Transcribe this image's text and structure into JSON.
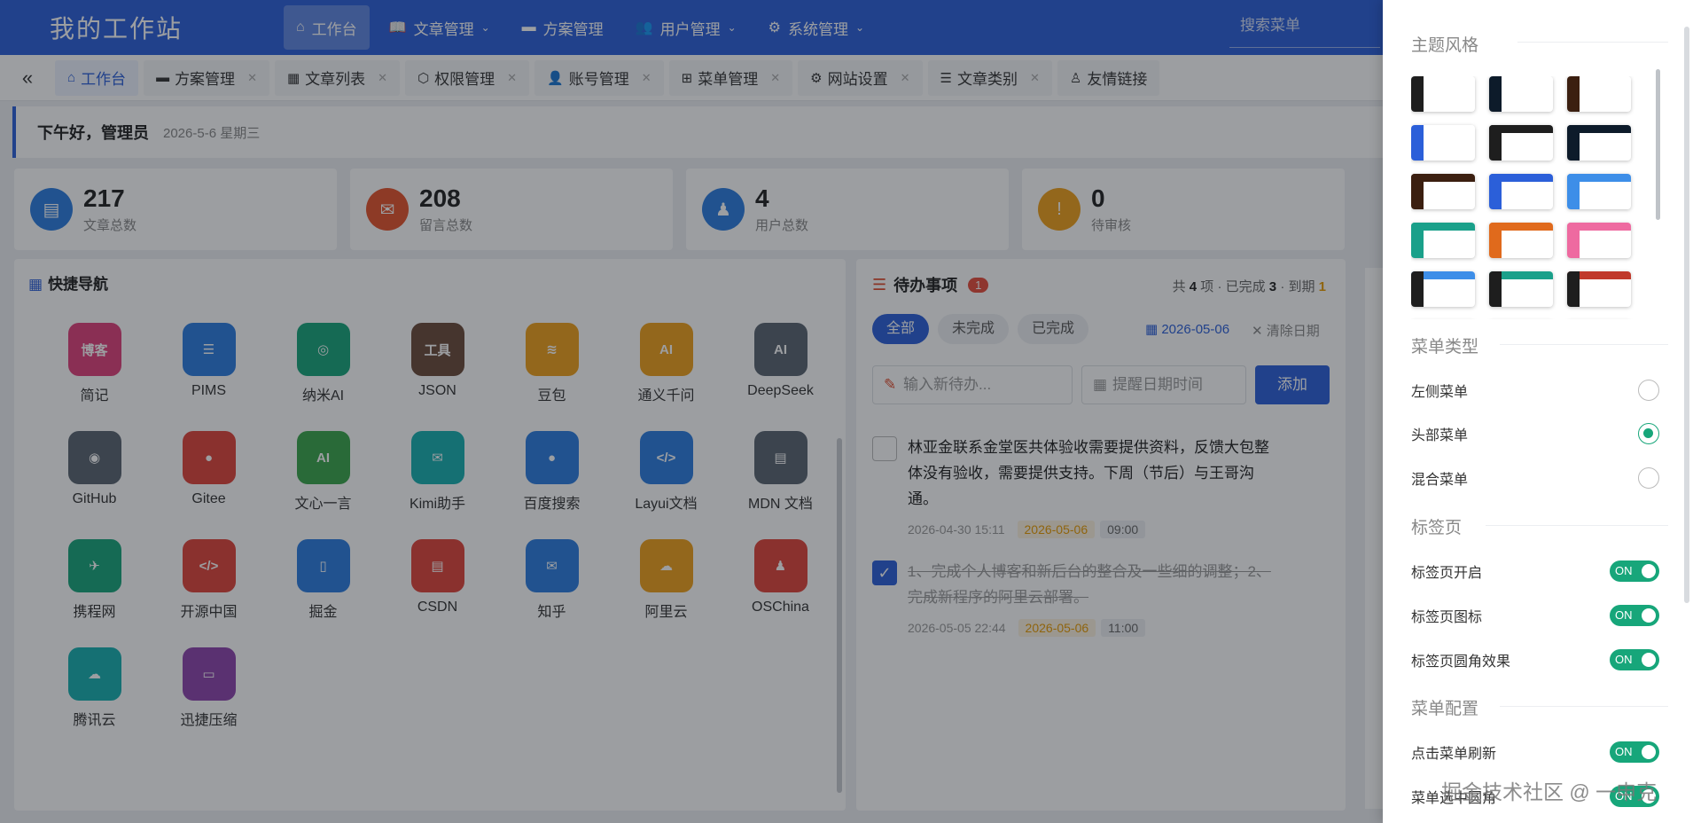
{
  "header": {
    "logo": "我的工作站",
    "nav": [
      {
        "label": "工作台",
        "icon": "home-icon",
        "active": true,
        "dropdown": false
      },
      {
        "label": "文章管理",
        "icon": "book-icon",
        "active": false,
        "dropdown": true
      },
      {
        "label": "方案管理",
        "icon": "comment-icon",
        "active": false,
        "dropdown": false
      },
      {
        "label": "用户管理",
        "icon": "users-icon",
        "active": false,
        "dropdown": true
      },
      {
        "label": "系统管理",
        "icon": "gear-icon",
        "active": false,
        "dropdown": true
      }
    ],
    "search_placeholder": "搜索菜单"
  },
  "tabs": [
    {
      "label": "工作台",
      "active": true,
      "closable": false
    },
    {
      "label": "方案管理",
      "closable": true
    },
    {
      "label": "文章列表",
      "closable": true
    },
    {
      "label": "权限管理",
      "closable": true
    },
    {
      "label": "账号管理",
      "closable": true
    },
    {
      "label": "菜单管理",
      "closable": true
    },
    {
      "label": "网站设置",
      "closable": true
    },
    {
      "label": "文章类别",
      "closable": true
    },
    {
      "label": "友情链接",
      "closable": false
    }
  ],
  "greeting": {
    "text": "下午好，管理员",
    "date": "2026-5-6 星期三"
  },
  "stats": [
    {
      "value": "217",
      "label": "文章总数",
      "color": "#2b7de0"
    },
    {
      "value": "208",
      "label": "留言总数",
      "color": "#e5532c"
    },
    {
      "value": "4",
      "label": "用户总数",
      "color": "#2b7de0"
    },
    {
      "value": "0",
      "label": "待审核",
      "color": "#f0a01b"
    }
  ],
  "quicknav": {
    "title": "快捷导航",
    "items": [
      {
        "label": "简记",
        "glyph": "博客",
        "color": "#e0407a"
      },
      {
        "label": "PIMS",
        "glyph": "☰",
        "color": "#2b7de0"
      },
      {
        "label": "纳米AI",
        "glyph": "◎",
        "color": "#17a67a"
      },
      {
        "label": "JSON",
        "glyph": "工具",
        "color": "#6b4a3a"
      },
      {
        "label": "豆包",
        "glyph": "≋",
        "color": "#f0a01b"
      },
      {
        "label": "通义千问",
        "glyph": "AI",
        "color": "#f0a01b"
      },
      {
        "label": "DeepSeek",
        "glyph": "AI",
        "color": "#5a6570"
      },
      {
        "label": "GitHub",
        "glyph": "◉",
        "color": "#5a6570"
      },
      {
        "label": "Gitee",
        "glyph": "●",
        "color": "#e0443a"
      },
      {
        "label": "文心一言",
        "glyph": "AI",
        "color": "#3aa64a"
      },
      {
        "label": "Kimi助手",
        "glyph": "✉",
        "color": "#17b0b0"
      },
      {
        "label": "百度搜索",
        "glyph": "●",
        "color": "#2b7de0"
      },
      {
        "label": "Layui文档",
        "glyph": "</>",
        "color": "#2b7de0"
      },
      {
        "label": "MDN 文档",
        "glyph": "▤",
        "color": "#5a6570"
      },
      {
        "label": "携程网",
        "glyph": "✈",
        "color": "#17a67a"
      },
      {
        "label": "开源中国",
        "glyph": "</>",
        "color": "#e0443a"
      },
      {
        "label": "掘金",
        "glyph": "▯",
        "color": "#2b7de0"
      },
      {
        "label": "CSDN",
        "glyph": "▤",
        "color": "#e0443a"
      },
      {
        "label": "知乎",
        "glyph": "✉",
        "color": "#2b7de0"
      },
      {
        "label": "阿里云",
        "glyph": "☁",
        "color": "#f0a01b"
      },
      {
        "label": "OSChina",
        "glyph": "♟",
        "color": "#e0443a"
      },
      {
        "label": "腾讯云",
        "glyph": "☁",
        "color": "#17b0b0"
      },
      {
        "label": "迅捷压缩",
        "glyph": "▭",
        "color": "#8e44ad"
      }
    ]
  },
  "todo": {
    "title": "待办事项",
    "badge": "1",
    "summary": {
      "prefix": "共",
      "total": "4",
      "total_unit": "项 · 已完成",
      "done": "3",
      "due_prefix": "· 到期",
      "due": "1"
    },
    "filters": [
      {
        "label": "全部",
        "active": true
      },
      {
        "label": "未完成",
        "active": false
      },
      {
        "label": "已完成",
        "active": false
      }
    ],
    "date_filter": "2026-05-06",
    "clear_date": "清除日期",
    "input_placeholder": "输入新待办...",
    "datetime_placeholder": "提醒日期时间",
    "add_label": "添加",
    "items": [
      {
        "text": "林亚金联系金堂医共体验收需要提供资料，反馈大包整体没有验收，需要提供支持。下周（节后）与王哥沟通。",
        "created": "2026-04-30 15:11",
        "due": "2026-05-06",
        "time": "09:00",
        "done": false
      },
      {
        "text": "1、完成个人博客和新后台的整合及一些细的调整；2、完成新程序的阿里云部署。",
        "created": "2026-05-05 22:44",
        "due": "2026-05-06",
        "time": "11:00",
        "done": true
      }
    ]
  },
  "drawer": {
    "theme_title": "主题风格",
    "themes": [
      {
        "side": "#1e1e1e",
        "top": "#ffffff"
      },
      {
        "side": "#0d1b2a",
        "top": "#ffffff"
      },
      {
        "side": "#3b1f10",
        "top": "#ffffff"
      },
      {
        "side": "#2b5fd9",
        "top": "#ffffff"
      },
      {
        "side": "#1e1e1e",
        "top": "#1e1e1e"
      },
      {
        "side": "#0d1b2a",
        "top": "#0d1b2a"
      },
      {
        "side": "#3b1f10",
        "top": "#3b1f10"
      },
      {
        "side": "#2b5fd9",
        "top": "#2b5fd9"
      },
      {
        "side": "#3d8ee8",
        "top": "#3d8ee8"
      },
      {
        "side": "#1aa08a",
        "top": "#1aa08a"
      },
      {
        "side": "#e06a1c",
        "top": "#e06a1c"
      },
      {
        "side": "#ee6aa0",
        "top": "#ee6aa0"
      },
      {
        "side": "#1e1e1e",
        "top": "#3d8ee8"
      },
      {
        "side": "#1e1e1e",
        "top": "#1aa08a"
      },
      {
        "side": "#1e1e1e",
        "top": "#c0392b"
      },
      {
        "side": "#ee6aa0",
        "top": "#ee6aa0"
      },
      {
        "side": "#1e1e1e",
        "top": "#1e1e1e"
      },
      {
        "side": "#e06a1c",
        "top": "#e06a1c"
      }
    ],
    "menu_type_title": "菜单类型",
    "menu_types": [
      {
        "label": "左侧菜单",
        "selected": false
      },
      {
        "label": "头部菜单",
        "selected": true
      },
      {
        "label": "混合菜单",
        "selected": false
      }
    ],
    "tabs_title": "标签页",
    "tab_options": [
      {
        "label": "标签页开启",
        "value": "ON"
      },
      {
        "label": "标签页图标",
        "value": "ON"
      },
      {
        "label": "标签页圆角效果",
        "value": "ON"
      }
    ],
    "menu_config_title": "菜单配置",
    "menu_options": [
      {
        "label": "点击菜单刷新",
        "value": "ON"
      },
      {
        "label": "菜单选中圆角",
        "value": "ON"
      }
    ]
  },
  "watermark": "掘金技术社区 @ 一申克"
}
